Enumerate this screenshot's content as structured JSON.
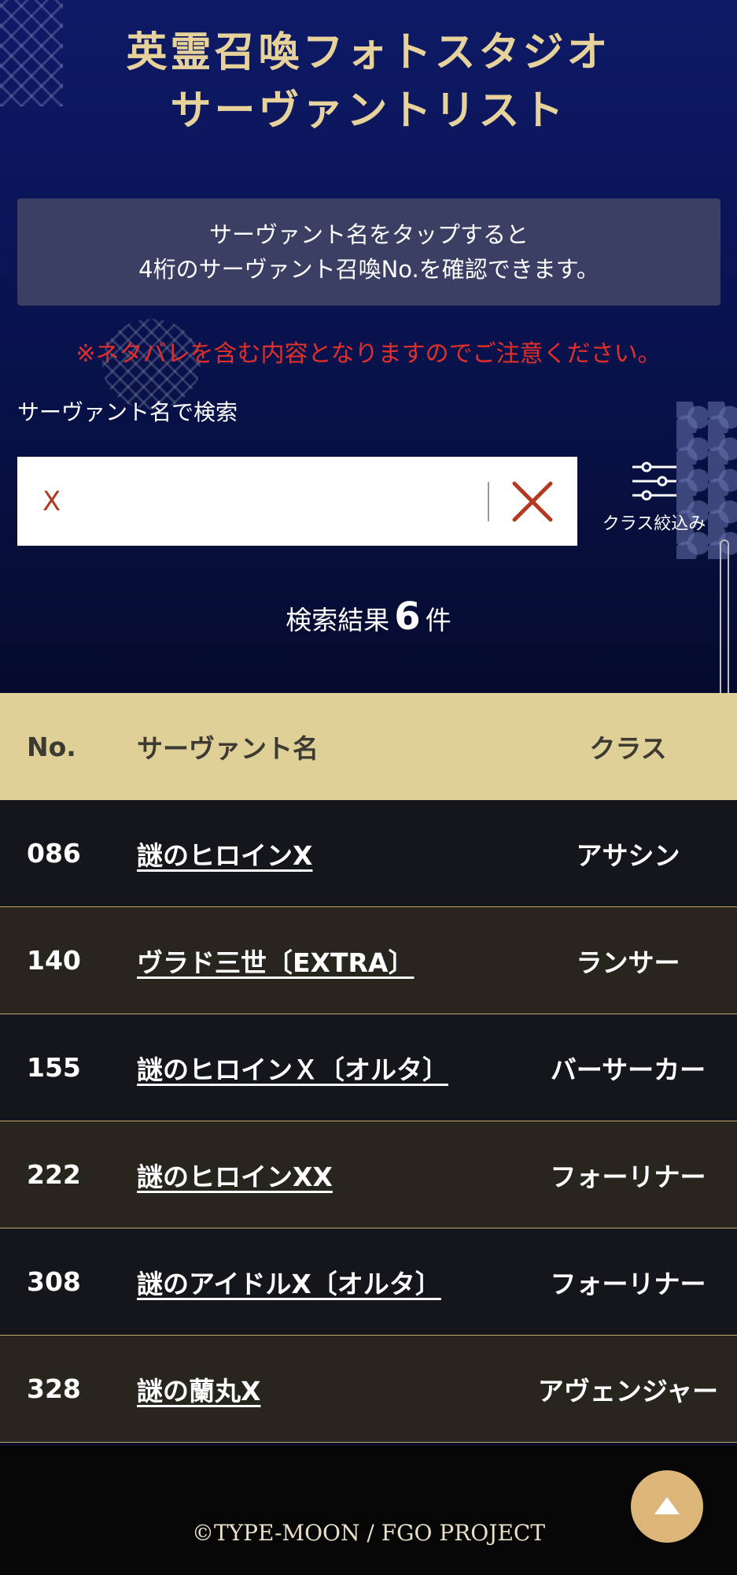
{
  "header": {
    "title_line1": "英霊召喚フォトスタジオ",
    "title_line2": "サーヴァントリスト"
  },
  "notice": {
    "line1": "サーヴァント名をタップすると",
    "line2": "4桁のサーヴァント召喚No.を確認できます。"
  },
  "warning": "※ネタバレを含む内容となりますのでご注意ください。",
  "search": {
    "label": "サーヴァント名で検索",
    "value": "X",
    "clear_icon": "close-icon"
  },
  "filter": {
    "label": "クラス絞込み",
    "icon": "sliders-icon"
  },
  "result": {
    "prefix": "検索結果",
    "count": "6",
    "suffix": "件"
  },
  "table": {
    "headers": {
      "no": "No.",
      "name": "サーヴァント名",
      "class": "クラス"
    },
    "rows": [
      {
        "no": "086",
        "name": "謎のヒロインX",
        "class": "アサシン"
      },
      {
        "no": "140",
        "name": "ヴラド三世〔EXTRA〕",
        "class": "ランサー"
      },
      {
        "no": "155",
        "name": "謎のヒロインＸ〔オルタ〕",
        "class": "バーサーカー"
      },
      {
        "no": "222",
        "name": "謎のヒロインXX",
        "class": "フォーリナー"
      },
      {
        "no": "308",
        "name": "謎のアイドルX〔オルタ〕",
        "class": "フォーリナー"
      },
      {
        "no": "328",
        "name": "謎の蘭丸X",
        "class": "アヴェンジャー"
      }
    ]
  },
  "footer": {
    "copyright": "©TYPE-MOON / FGO PROJECT",
    "top_icon": "arrow-up-icon"
  },
  "colors": {
    "accent_gold": "#e6d29a",
    "warning_red": "#e1302a",
    "table_header": "#ded096",
    "button_gold": "#dcb679"
  }
}
